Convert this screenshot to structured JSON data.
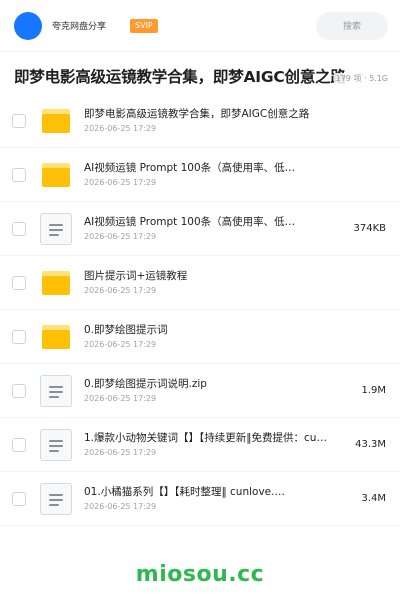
{
  "header": {
    "brand": "夸克网盘分享",
    "badge": "SVIP",
    "search_placeholder": "搜索"
  },
  "share": {
    "title": "即梦电影高级运镜教学合集，即梦AIGC创意之路",
    "meta": "179 项 · 5.1G"
  },
  "files": [
    {
      "type": "folder",
      "icon": "folder-icon",
      "name": "即梦电影高级运镜教学合集，即梦AIGC创意之路",
      "date": "2026-06-25 17:29",
      "size": ""
    },
    {
      "type": "folder",
      "icon": "folder-icon",
      "name": "AI视频运镜 Prompt 100条（高使用率、低…",
      "date": "2026-06-25 17:29",
      "size": ""
    },
    {
      "type": "file",
      "icon": "document-icon",
      "name": "AI视频运镜 Prompt 100条（高使用率、低…",
      "date": "2026-06-25 17:29",
      "size": "374KB"
    },
    {
      "type": "folder",
      "icon": "folder-icon",
      "name": "图片提示词+运镜教程",
      "date": "2026-06-25 17:29",
      "size": ""
    },
    {
      "type": "folder",
      "icon": "folder-icon",
      "name": "0.即梦绘图提示词",
      "date": "2026-06-25 17:29",
      "size": ""
    },
    {
      "type": "file",
      "icon": "document-icon",
      "name": "0.即梦绘图提示词说明.zip",
      "date": "2026-06-25 17:29",
      "size": "1.9M"
    },
    {
      "type": "file",
      "icon": "document-icon",
      "name": "1.爆款小动物关键词【】【持续更新‖免费提供：cu…",
      "date": "2026-06-25 17:29",
      "size": "43.3M"
    },
    {
      "type": "file",
      "icon": "document-icon",
      "name": "01.小橘猫系列【】【耗时整理‖ cunlove.…",
      "date": "2026-06-25 17:29",
      "size": "3.4M"
    }
  ],
  "watermark": "miosou.cc",
  "colors": {
    "accent": "#1677ff",
    "badge": "#ff9a2e",
    "folder": "#ffc107",
    "watermark": "#2eb84f"
  }
}
